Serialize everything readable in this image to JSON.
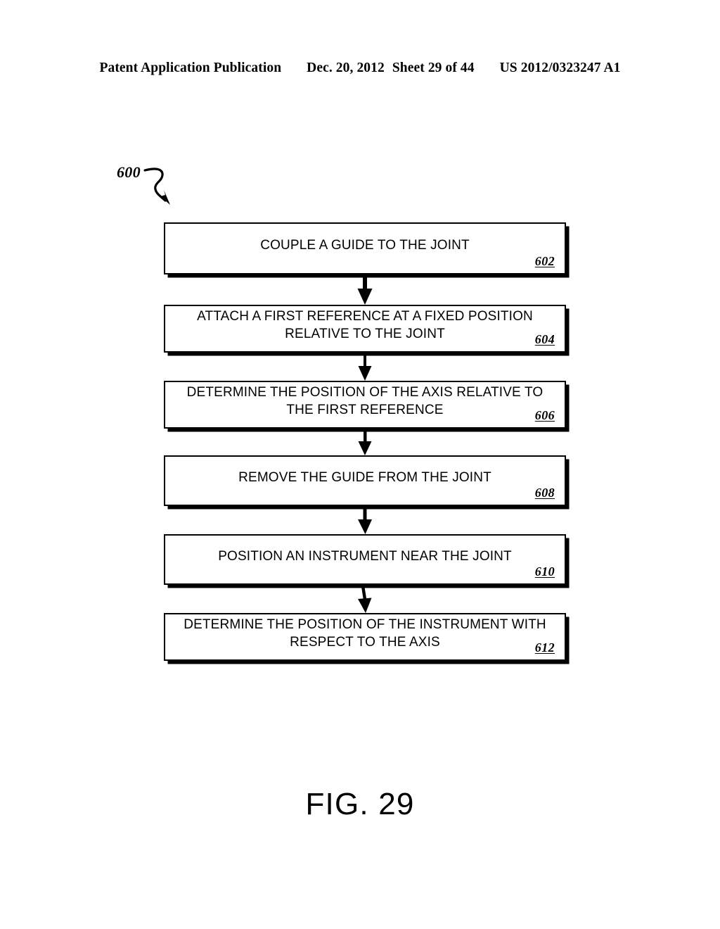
{
  "header": {
    "publication": "Patent Application Publication",
    "date": "Dec. 20, 2012",
    "sheet": "Sheet 29 of 44",
    "publication_number": "US 2012/0323247 A1"
  },
  "figure": {
    "caption": "FIG. 29",
    "callout_ref": "600",
    "callout_icon": "curved-arrow-icon"
  },
  "flowchart": {
    "steps": [
      {
        "text": "COUPLE A GUIDE TO THE JOINT",
        "ref": "602"
      },
      {
        "text": "ATTACH A FIRST REFERENCE AT A FIXED POSITION\nRELATIVE TO THE JOINT",
        "ref": "604"
      },
      {
        "text": "DETERMINE THE POSITION OF THE AXIS RELATIVE TO\nTHE FIRST REFERENCE",
        "ref": "606"
      },
      {
        "text": "REMOVE THE GUIDE FROM THE JOINT",
        "ref": "608"
      },
      {
        "text": "POSITION AN INSTRUMENT NEAR THE JOINT",
        "ref": "610"
      },
      {
        "text": "DETERMINE THE POSITION OF THE INSTRUMENT WITH\nRESPECT TO THE AXIS",
        "ref": "612"
      }
    ],
    "connector_icon": "down-arrow-icon"
  },
  "colors": {
    "ink": "#000000",
    "page": "#ffffff"
  }
}
